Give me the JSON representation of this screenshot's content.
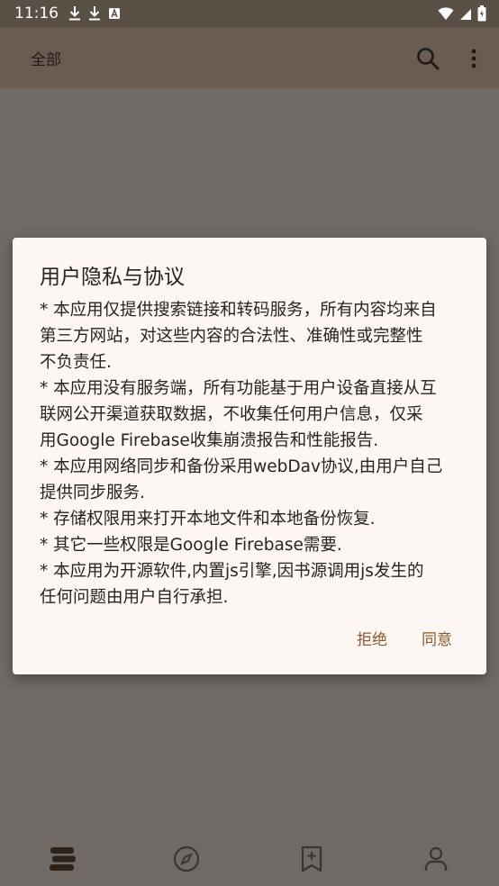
{
  "status_bar": {
    "time": "11:16",
    "left_icons": [
      "download-icon",
      "download-icon",
      "text-a-icon"
    ],
    "right_icons": [
      "wifi-icon",
      "signal-icon",
      "battery-icon"
    ]
  },
  "app_bar": {
    "tab_label": "全部",
    "actions": [
      "search-icon",
      "more-vert-icon"
    ]
  },
  "bottom_nav": {
    "items": [
      "bookshelf-icon",
      "explore-icon",
      "bookmark-add-icon",
      "person-icon"
    ]
  },
  "dialog": {
    "title": "用户隐私与协议",
    "lines": [
      "* 本应用仅提供搜索链接和转码服务，所有内容均来自",
      "第三方网站，对这些内容的合法性、准确性或完整性",
      "不负责任.",
      "* 本应用没有服务端，所有功能基于用户设备直接从互",
      "联网公开渠道获取数据，不收集任何用户信息，仅采",
      "用Google Firebase收集崩溃报告和性能报告.",
      "* 本应用网络同步和备份采用webDav协议,由用户自己",
      "提供同步服务.",
      "* 存储权限用来打开本地文件和本地备份恢复.",
      "* 其它一些权限是Google Firebase需要.",
      "* 本应用为开源软件,内置js引擎,因书源调用js发生的",
      "任何问题由用户自行承担."
    ],
    "reject_label": "拒绝",
    "agree_label": "同意"
  },
  "colors": {
    "accent": "#8a5a2e",
    "scrim": "#6f6a66",
    "dialog_bg": "#fdf7f3"
  }
}
